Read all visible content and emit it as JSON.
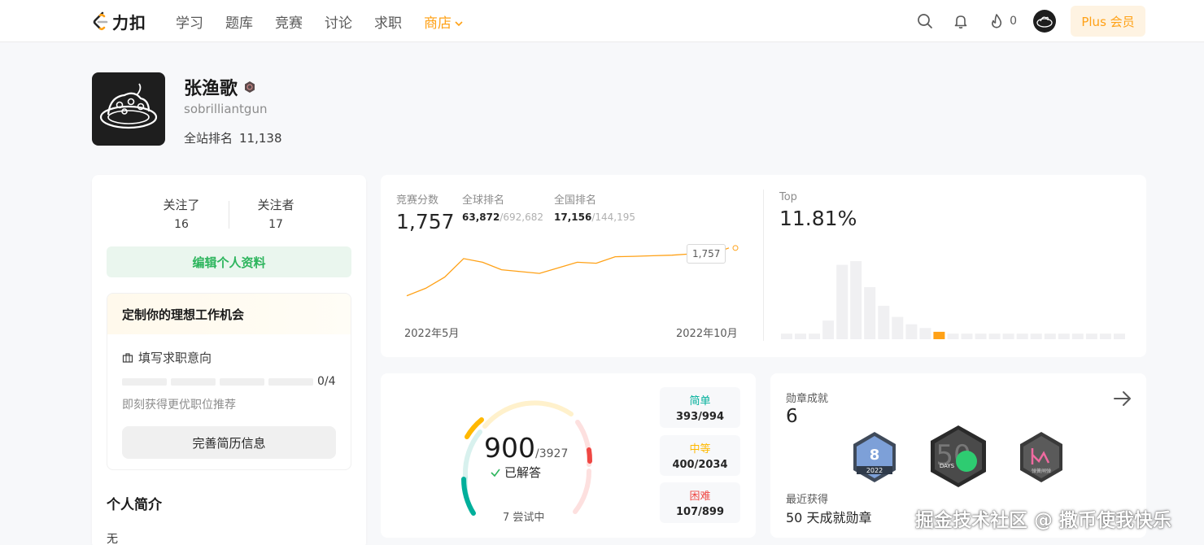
{
  "nav": {
    "brand": "力扣",
    "links": [
      {
        "label": "学习",
        "active": false
      },
      {
        "label": "题库",
        "active": false
      },
      {
        "label": "竞赛",
        "active": false
      },
      {
        "label": "讨论",
        "active": false
      },
      {
        "label": "求职",
        "active": false
      },
      {
        "label": "商店",
        "active": true
      }
    ],
    "fire_count": "0",
    "plus_label": "Plus 会员",
    "accent": "#ffa116"
  },
  "profile": {
    "name": "张渔歌",
    "slug": "sobrilliantgun",
    "rank_label": "全站排名",
    "rank_value": "11,138"
  },
  "sidebar": {
    "following_label": "关注了",
    "following_value": "16",
    "followers_label": "关注者",
    "followers_value": "17",
    "edit_label": "编辑个人资料",
    "job": {
      "title": "定制你的理想工作机会",
      "intent_label": "填写求职意向",
      "progress": "0/4",
      "progress_fraction": 0,
      "tip": "即刻获得更优职位推荐",
      "resume_label": "完善简历信息"
    },
    "intro_title": "个人简介",
    "intro_value": "无"
  },
  "contest": {
    "score_label": "竞赛分数",
    "score": "1,757",
    "global_label": "全球排名",
    "global_rank": "63,872",
    "global_total": "/692,682",
    "national_label": "全国排名",
    "national_rank": "17,156",
    "national_total": "/144,195",
    "tooltip": "1,757",
    "date_start": "2022年5月",
    "date_end": "2022年10月",
    "top_label": "Top",
    "top_value": "11.81%"
  },
  "chart_data": [
    {
      "type": "line",
      "title": "",
      "xlabel": "",
      "ylabel": "",
      "x_range": [
        "2022年5月",
        "2022年10月"
      ],
      "series": [
        {
          "values": [
            1500,
            1540,
            1600,
            1700,
            1680,
            1640,
            1630,
            1620,
            1650,
            1680,
            1675,
            1710,
            1712,
            1715,
            1718,
            1725,
            1720,
            1757
          ]
        }
      ],
      "ylim": [
        1450,
        1800
      ],
      "line_color": "#ffa116"
    },
    {
      "type": "bar",
      "title": "",
      "values": [
        3,
        3,
        3,
        10,
        40,
        42,
        28,
        18,
        12,
        8,
        6,
        4,
        3,
        3,
        3,
        3,
        3,
        3,
        3,
        3,
        3,
        3,
        3,
        3,
        3
      ],
      "highlight_index": 11,
      "highlight_color": "#ffa116",
      "bar_color": "#f0f0f2"
    }
  ],
  "solved": {
    "solved": "900",
    "total": "/3927",
    "solved_label": "已解答",
    "attempting": "7 尝试中",
    "easy_label": "简单",
    "easy_value": "393/994",
    "medium_label": "中等",
    "medium_value": "400/2034",
    "hard_label": "困难",
    "hard_value": "107/899",
    "colors": {
      "easy": "#00af9b",
      "medium": "#ffb800",
      "hard": "#ef4743"
    }
  },
  "badges": {
    "title": "勋章成就",
    "count": "6",
    "recent_label": "最近获得",
    "recent_value": "50 天成就勋章",
    "items": [
      {
        "name": "2022",
        "digit": "8"
      },
      {
        "name": "DAYS",
        "digit": "50"
      },
      {
        "name": "弹簧闸弹"
      }
    ]
  },
  "watermark": "掘金技术社区 @ 撒币使我快乐"
}
